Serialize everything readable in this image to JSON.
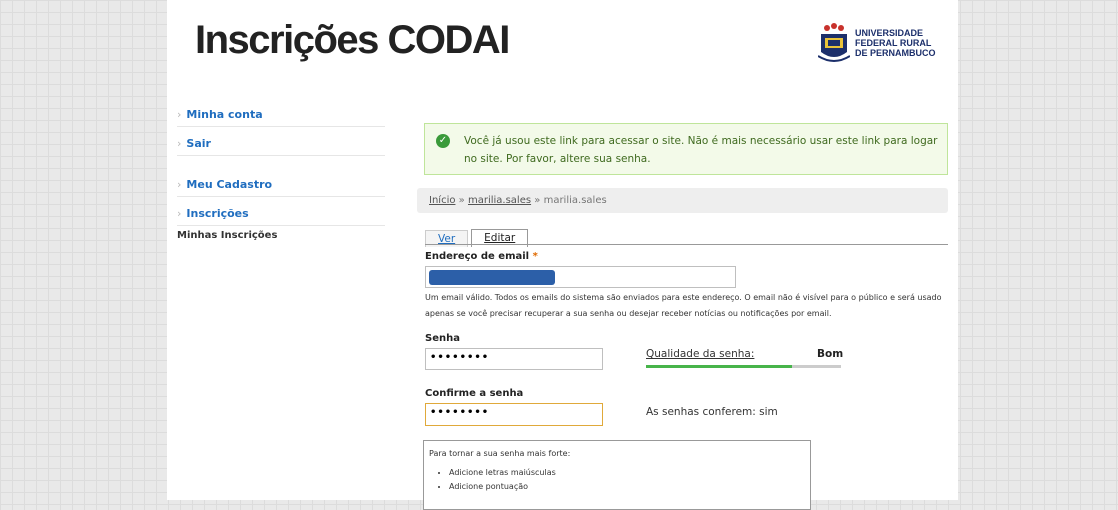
{
  "header": {
    "site_title": "Inscrições CODAI",
    "logo_lines": [
      "UNIVERSIDADE",
      "FEDERAL RURAL",
      "DE PERNAMBUCO"
    ]
  },
  "sidebar": {
    "items": [
      {
        "label": "Minha conta"
      },
      {
        "label": "Sair"
      },
      {
        "label": "Meu Cadastro"
      },
      {
        "label": "Inscrições"
      }
    ],
    "sub_item": "Minhas Inscrições"
  },
  "message": {
    "text": "Você já usou este link para acessar o site. Não é mais necessário usar este link para logar no site. Por favor, altere sua senha."
  },
  "breadcrumb": {
    "home": "Início",
    "separator": "»",
    "user": "marilia.sales",
    "current": "marilia.sales"
  },
  "tabs": [
    {
      "label": "Ver"
    },
    {
      "label": "Editar"
    }
  ],
  "form": {
    "email_label": "Endereço de email",
    "required_mark": "*",
    "email_description": "Um email válido. Todos os emails do sistema são enviados para este endereço. O email não é visível para o público e será usado apenas se você precisar recuperar a sua senha ou desejar receber notícias ou notificações por email.",
    "password_label": "Senha",
    "password_value": "••••••••",
    "strength_label": "Qualidade da senha:",
    "strength_value": "Bom",
    "strength_fraction": 0.75,
    "confirm_label": "Confirme a senha",
    "confirm_value": "••••••••",
    "match_text": "As senhas conferem: sim",
    "tips_title": "Para tornar a sua senha mais forte:",
    "tips": [
      "Adicione letras maiúsculas",
      "Adicione pontuação"
    ]
  },
  "colors": {
    "link": "#1f6dbf",
    "success_bg": "#f3fae9",
    "success_border": "#bfe59a",
    "strength_fill": "#47b44a"
  }
}
